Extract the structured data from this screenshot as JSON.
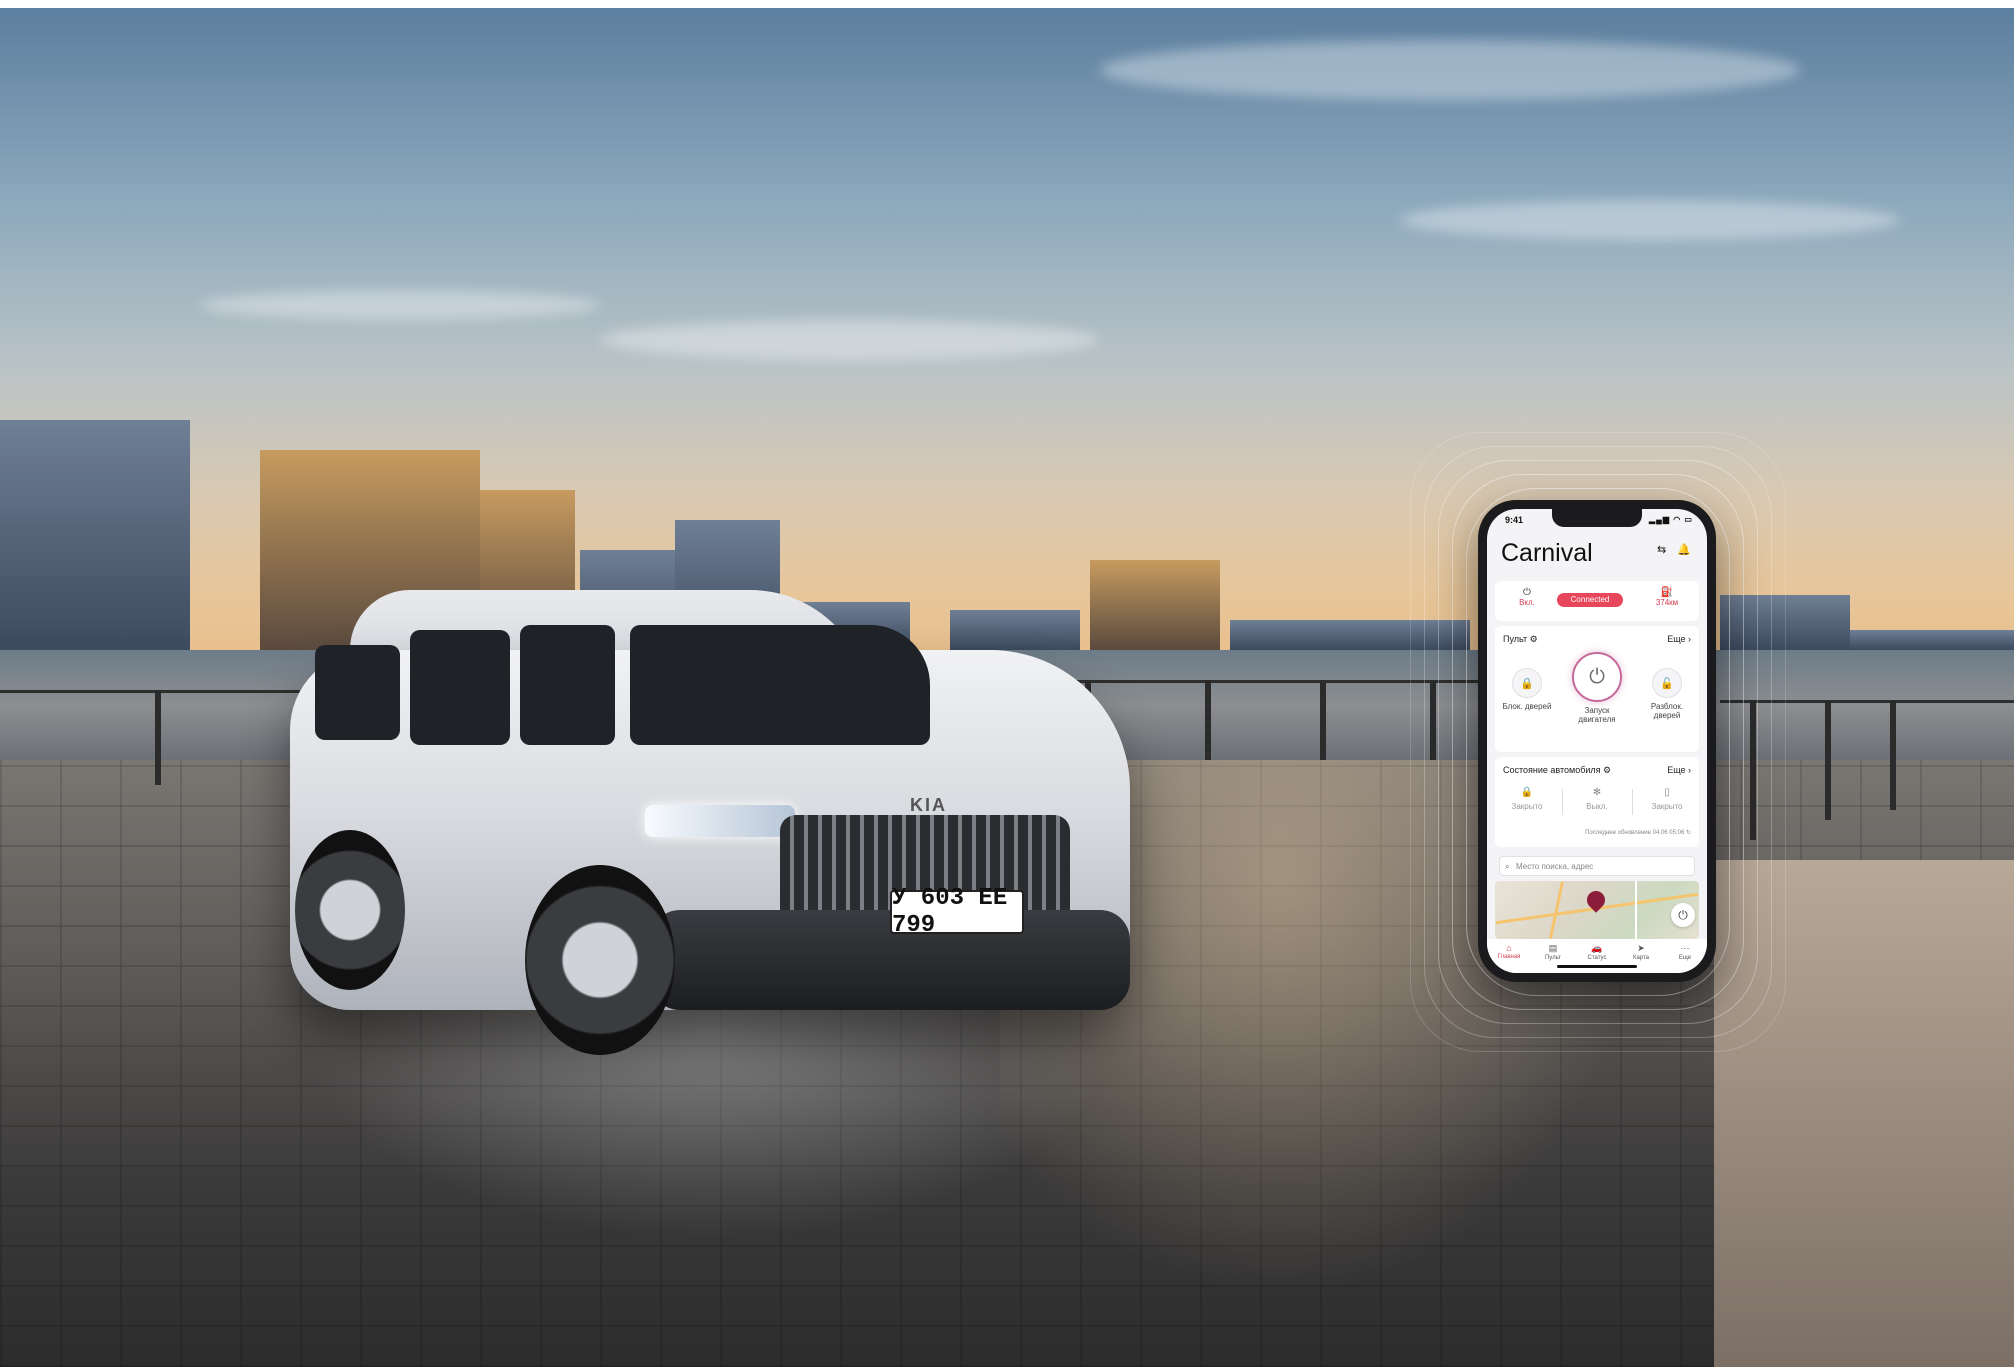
{
  "car": {
    "plate": "У 603 ЕЕ 799",
    "brand_logo": "KIA"
  },
  "app": {
    "status_bar": {
      "time": "9:41",
      "icons": "▂▄▆ ◠ ▭"
    },
    "title": "Carnival",
    "header_icons": {
      "switch": "⇆",
      "bell": "🔔"
    },
    "info": {
      "power": {
        "icon": "⏻",
        "label": "Вкл."
      },
      "connection": "Connected",
      "range": {
        "icon": "⛽",
        "label": "374км"
      }
    },
    "remote": {
      "title": "Пульт ⚙",
      "more": "Еще ›",
      "lock": {
        "icon": "🔒",
        "label": "Блок. дверей"
      },
      "start": {
        "icon": "⏻",
        "label": "Запуск двигателя"
      },
      "unlock": {
        "icon": "🔓",
        "label": "Разблок. дверей"
      }
    },
    "vehicle_state": {
      "title": "Состояние автомобиля ⚙",
      "more": "Еще ›",
      "doors": {
        "icon": "🔒",
        "label": "Закрыто"
      },
      "climate": {
        "icon": "✻",
        "label": "Выкл."
      },
      "trunk": {
        "icon": "▯",
        "label": "Закрыто"
      },
      "last_update": "Последнее обновление 04.06 05:06 ↻"
    },
    "search": {
      "icon": "⌕",
      "placeholder": "Место поиска, адрес"
    },
    "map_power_icon": "⏻",
    "tabs": [
      {
        "icon": "⌂",
        "label": "Главная"
      },
      {
        "icon": "▤",
        "label": "Пульт"
      },
      {
        "icon": "🚗",
        "label": "Статус"
      },
      {
        "icon": "➤",
        "label": "Карта"
      },
      {
        "icon": "⋯",
        "label": "Еще"
      }
    ]
  }
}
